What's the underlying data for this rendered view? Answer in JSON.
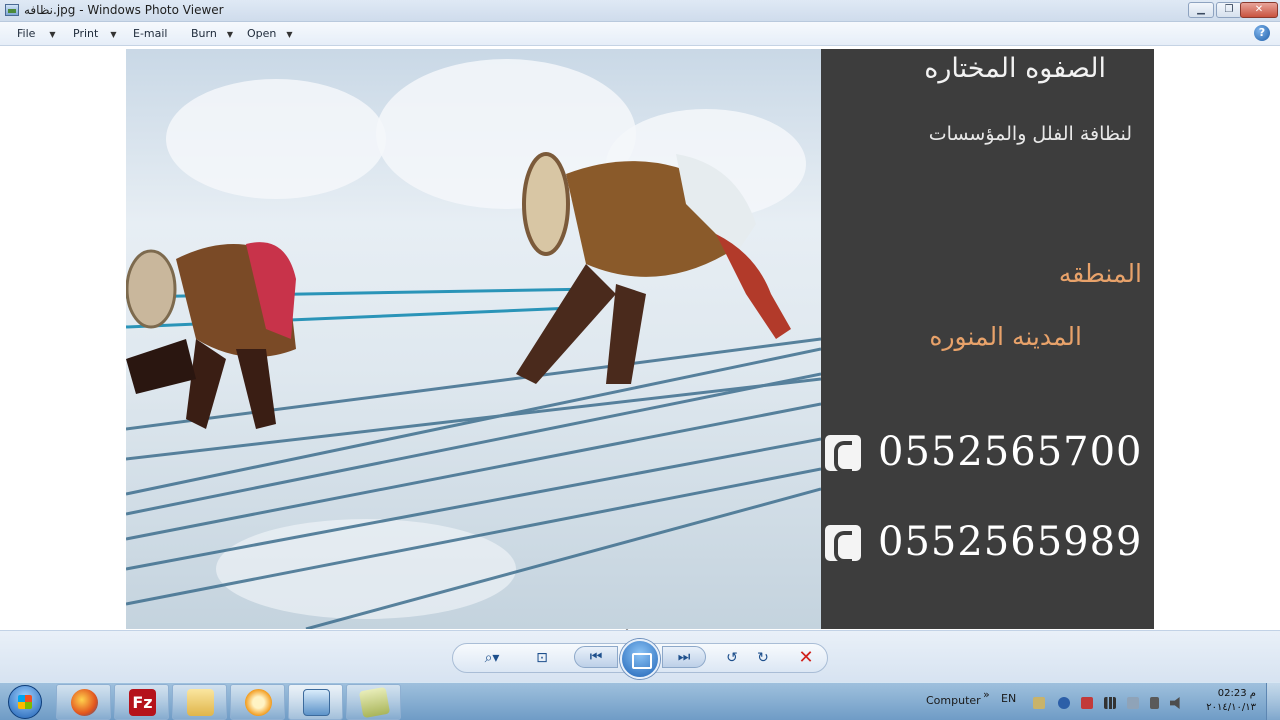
{
  "window": {
    "title": "نظافه.jpg - Windows Photo Viewer",
    "icon": "photo-viewer-icon",
    "buttons": {
      "minimize": "▁",
      "maximize": "❐",
      "close": "✕"
    }
  },
  "menu": {
    "items": [
      {
        "label": "File",
        "has_dropdown": true
      },
      {
        "label": "Print",
        "has_dropdown": true
      },
      {
        "label": "E-mail",
        "has_dropdown": false
      },
      {
        "label": "Burn",
        "has_dropdown": true
      },
      {
        "label": "Open",
        "has_dropdown": true
      }
    ],
    "help_glyph": "?"
  },
  "image": {
    "ad": {
      "title": "الصفوه المختاره",
      "subtitle": "لنظافة الفلل والمؤسسات",
      "region_label": "المنطقه",
      "region": "المدينه المنوره",
      "phones": [
        "0552565700",
        "0552565989"
      ],
      "accent_color": "#e8a26a",
      "panel_color": "#3d3d3d"
    }
  },
  "controls": {
    "zoom": "⌕▾",
    "actual_size": "⊡",
    "previous": "⏮",
    "next": "⏭",
    "rotate_ccw": "↺",
    "rotate_cw": "↻",
    "delete": "✕"
  },
  "taskbar": {
    "apps": [
      "firefox-icon",
      "filezilla-icon",
      "file-explorer-icon",
      "media-player-icon",
      "photo-viewer-icon",
      "notepad-icon"
    ],
    "tray": {
      "toolbar_label": "Computer",
      "toolbar_chevron": "»",
      "language": "EN",
      "time": "02:23 م",
      "date": "٢٠١٤/١٠/١٣"
    }
  }
}
